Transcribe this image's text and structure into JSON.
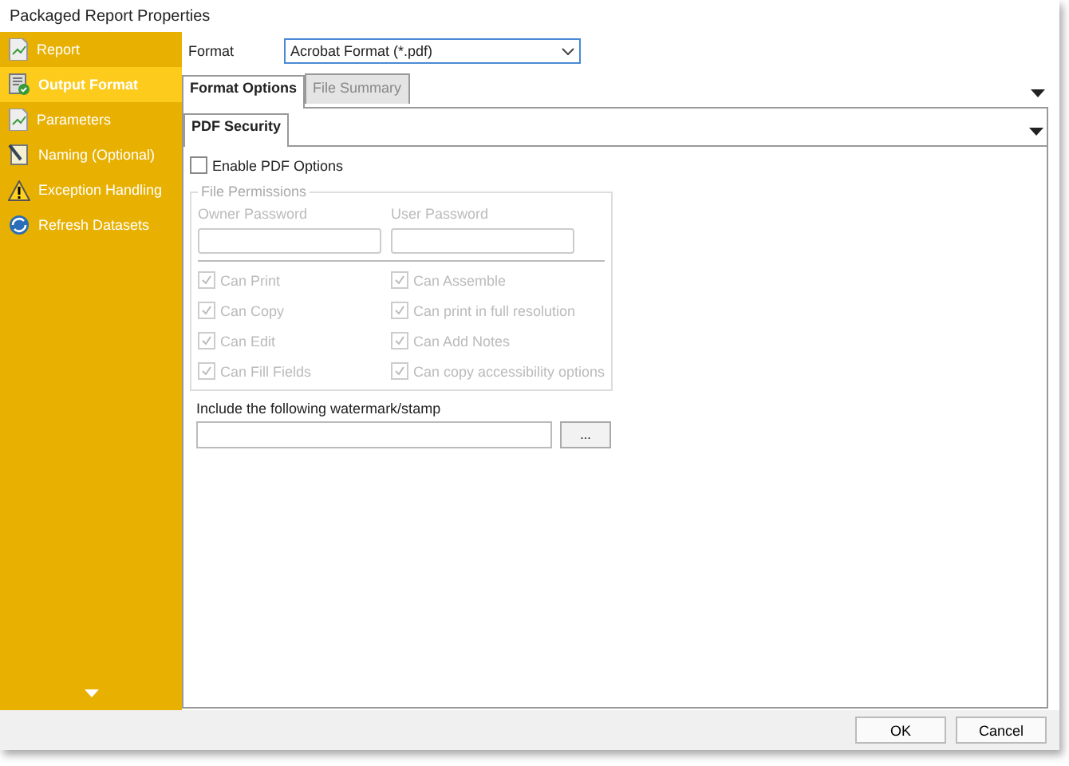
{
  "window": {
    "title": "Packaged Report Properties"
  },
  "sidebar": {
    "items": [
      {
        "label": "Report",
        "selected": false
      },
      {
        "label": "Output Format",
        "selected": true
      },
      {
        "label": "Parameters",
        "selected": false
      },
      {
        "label": "Naming (Optional)",
        "selected": false
      },
      {
        "label": "Exception Handling",
        "selected": false
      },
      {
        "label": "Refresh Datasets",
        "selected": false
      }
    ]
  },
  "format": {
    "label": "Format",
    "value": "Acrobat Format (*.pdf)"
  },
  "tabs": [
    {
      "label": "Format Options",
      "selected": true
    },
    {
      "label": "File Summary",
      "selected": false
    }
  ],
  "subtabs": [
    {
      "label": "PDF Security",
      "selected": true
    }
  ],
  "enable_pdf_options": {
    "label": "Enable PDF Options",
    "checked": false
  },
  "file_permissions": {
    "title": "File Permissions",
    "owner_password": {
      "label": "Owner Password"
    },
    "user_password": {
      "label": "User Password"
    },
    "options": [
      {
        "label": "Can Print",
        "checked": true,
        "disabled": true
      },
      {
        "label": "Can Assemble",
        "checked": true,
        "disabled": true
      },
      {
        "label": "Can Copy",
        "checked": true,
        "disabled": true
      },
      {
        "label": "Can print in full resolution",
        "checked": true,
        "disabled": true
      },
      {
        "label": "Can Edit",
        "checked": true,
        "disabled": true
      },
      {
        "label": "Can Add Notes",
        "checked": true,
        "disabled": true
      },
      {
        "label": "Can Fill Fields",
        "checked": true,
        "disabled": true
      },
      {
        "label": "Can copy accessibility options",
        "checked": true,
        "disabled": true
      }
    ]
  },
  "watermark": {
    "label": "Include the following watermark/stamp",
    "browse_button": "..."
  },
  "buttons": [
    "OK",
    "Cancel"
  ]
}
